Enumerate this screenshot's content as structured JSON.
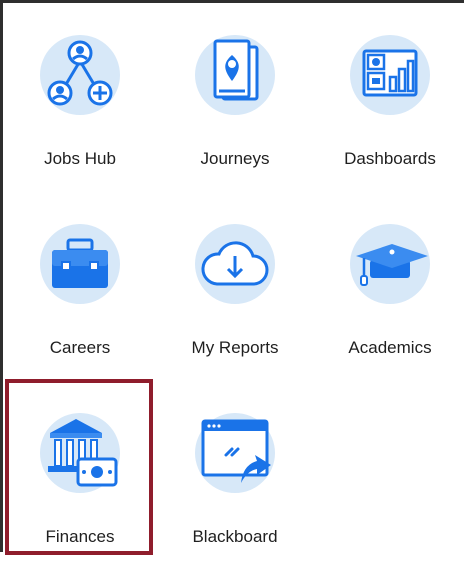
{
  "apps": [
    {
      "label": "Jobs Hub",
      "icon": "jobs-hub-icon"
    },
    {
      "label": "Journeys",
      "icon": "journeys-icon"
    },
    {
      "label": "Dashboards",
      "icon": "dashboards-icon"
    },
    {
      "label": "Careers",
      "icon": "careers-icon"
    },
    {
      "label": "My Reports",
      "icon": "my-reports-icon"
    },
    {
      "label": "Academics",
      "icon": "academics-icon"
    },
    {
      "label": "Finances",
      "icon": "finances-icon"
    },
    {
      "label": "Blackboard",
      "icon": "blackboard-icon"
    }
  ],
  "selected_app": "Finances",
  "colors": {
    "icon_bg": "#d7e8f8",
    "icon_blue": "#1a73e8",
    "highlight_border": "#8f1d2c",
    "text": "#1f1f1f"
  }
}
